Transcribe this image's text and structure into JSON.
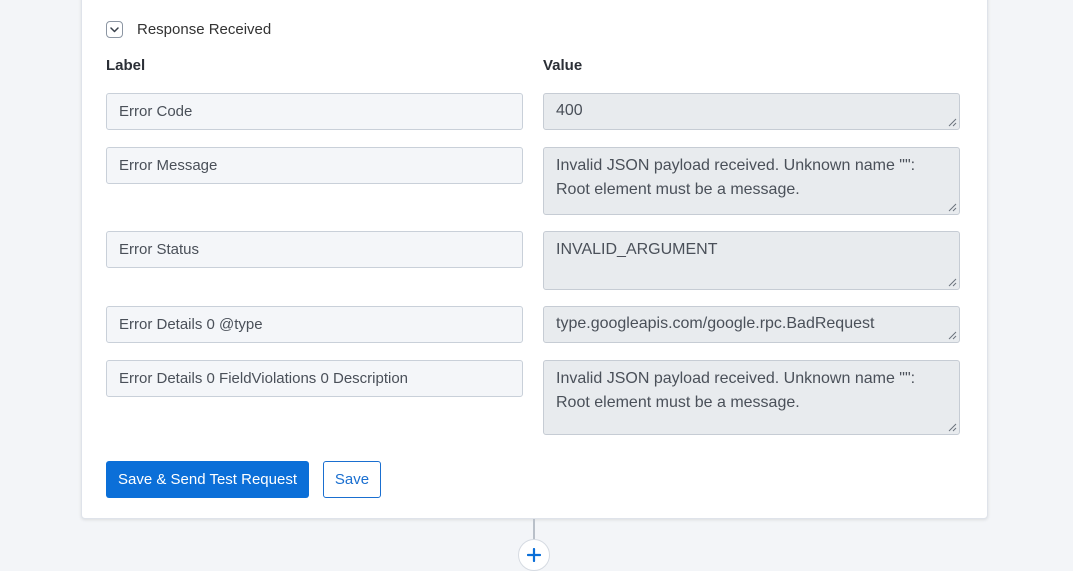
{
  "section": {
    "title": "Response Received",
    "toggle_icon": "chevron-down-icon"
  },
  "columns": {
    "label": "Label",
    "value": "Value"
  },
  "rows": [
    {
      "label": "Error Code",
      "value": "400"
    },
    {
      "label": "Error Message",
      "value": "Invalid JSON payload received. Unknown name \"\": Root element must be a message."
    },
    {
      "label": "Error Status",
      "value": "INVALID_ARGUMENT"
    },
    {
      "label": "Error Details 0 @type",
      "value": "type.googleapis.com/google.rpc.BadRequest"
    },
    {
      "label": "Error Details 0 FieldViolations 0 Description",
      "value": "Invalid JSON payload received. Unknown name \"\": Root element must be a message."
    }
  ],
  "actions": {
    "save_send": "Save & Send Test Request",
    "save": "Save"
  },
  "add_step_icon": "plus-icon",
  "colors": {
    "primary": "#0b6fd8",
    "field_bg": "#f4f6f9",
    "value_bg": "#e8ebee"
  }
}
